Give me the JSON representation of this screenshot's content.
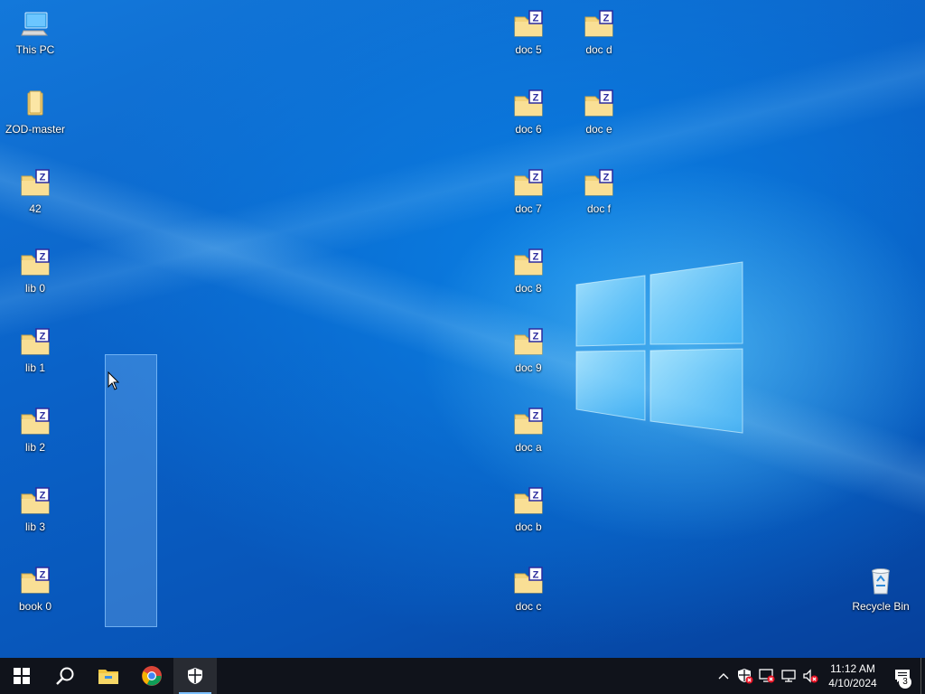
{
  "desktop": {
    "icons": [
      {
        "label": "This PC",
        "icon": "computer-icon"
      },
      {
        "label": "ZOD-master",
        "icon": "folder-icon"
      },
      {
        "label": "42",
        "icon": "zipped-folder-icon"
      },
      {
        "label": "lib 0",
        "icon": "zipped-folder-icon"
      },
      {
        "label": "lib 1",
        "icon": "zipped-folder-icon"
      },
      {
        "label": "lib 2",
        "icon": "zipped-folder-icon"
      },
      {
        "label": "lib 3",
        "icon": "zipped-folder-icon"
      },
      {
        "label": "book 0",
        "icon": "zipped-folder-icon"
      },
      {
        "label": "doc 5",
        "icon": "zipped-folder-icon"
      },
      {
        "label": "doc 6",
        "icon": "zipped-folder-icon"
      },
      {
        "label": "doc 7",
        "icon": "zipped-folder-icon"
      },
      {
        "label": "doc 8",
        "icon": "zipped-folder-icon"
      },
      {
        "label": "doc 9",
        "icon": "zipped-folder-icon"
      },
      {
        "label": "doc a",
        "icon": "zipped-folder-icon"
      },
      {
        "label": "doc b",
        "icon": "zipped-folder-icon"
      },
      {
        "label": "doc c",
        "icon": "zipped-folder-icon"
      },
      {
        "label": "doc d",
        "icon": "zipped-folder-icon"
      },
      {
        "label": "doc e",
        "icon": "zipped-folder-icon"
      },
      {
        "label": "doc f",
        "icon": "zipped-folder-icon"
      },
      {
        "label": "Recycle Bin",
        "icon": "recycle-bin-icon"
      }
    ]
  },
  "taskbar": {
    "apps": [
      {
        "name": "start",
        "icon": "windows-start-icon"
      },
      {
        "name": "search",
        "icon": "search-icon"
      },
      {
        "name": "file-explorer",
        "icon": "file-explorer-icon"
      },
      {
        "name": "chrome",
        "icon": "chrome-icon"
      },
      {
        "name": "windows-security",
        "icon": "shield-icon",
        "active": true
      }
    ],
    "tray": {
      "icons": [
        "chevron-up-icon",
        "security-warning-icon",
        "network-warning-icon",
        "network-icon",
        "volume-muted-icon"
      ],
      "time": "11:12 AM",
      "date": "4/10/2024",
      "notification_count": "3"
    }
  },
  "colors": {
    "taskbar_bg": "#10131b",
    "desktop_accent": "#0a7fe3",
    "folder_yellow": "#f5d77b",
    "zip_blue": "#2b2b9e"
  }
}
